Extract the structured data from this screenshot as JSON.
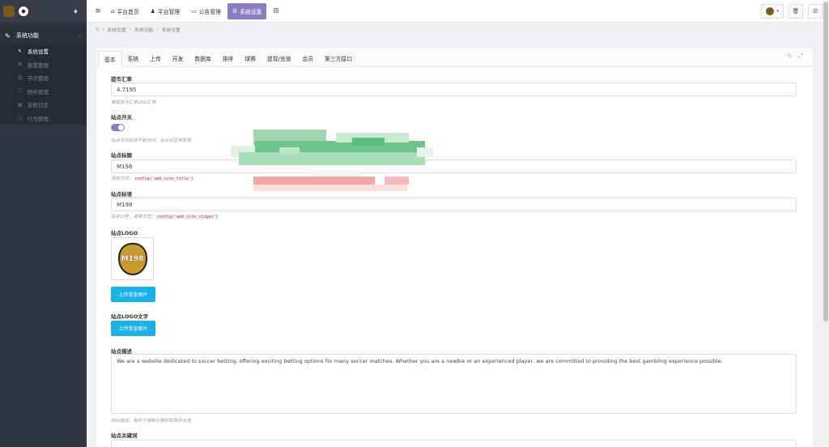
{
  "sidebar": {
    "group_label": "系统功能",
    "items": [
      {
        "label": "系统设置",
        "icon": "wrench-icon",
        "glyph": "✎",
        "active": true
      },
      {
        "label": "配置管理",
        "icon": "config-icon",
        "glyph": "⚙",
        "active": false
      },
      {
        "label": "节点管理",
        "icon": "node-icon",
        "glyph": "☰",
        "active": false
      },
      {
        "label": "附件管理",
        "icon": "attachment-icon",
        "glyph": "☐",
        "active": false
      },
      {
        "label": "系统日志",
        "icon": "log-icon",
        "glyph": "▤",
        "active": false
      },
      {
        "label": "行为管理",
        "icon": "action-icon",
        "glyph": "▢",
        "active": false
      }
    ]
  },
  "topnav": {
    "items": [
      {
        "label": "平台首页",
        "icon": "home-icon",
        "glyph": "⌂"
      },
      {
        "label": "平台管理",
        "icon": "user-icon",
        "glyph": "♟"
      },
      {
        "label": "公告管理",
        "icon": "notice-icon",
        "glyph": "▭"
      },
      {
        "label": "系统设置",
        "icon": "gear-icon",
        "glyph": "⚙",
        "active": true
      }
    ]
  },
  "breadcrumb": [
    "系统设置",
    "系统功能",
    "系统设置"
  ],
  "tabs": [
    "基本",
    "系统",
    "上传",
    "开发",
    "数据库",
    "排序",
    "球赛",
    "提现/充值",
    "会员",
    "第三方接口"
  ],
  "form": {
    "rate_label": "提币汇率",
    "rate_value": "4.7195",
    "rate_help": "美国货币汇率USD汇率",
    "switch_label": "站点开关",
    "switch_help": "站点关闭后将不能访问，后台可正常登录",
    "title_label": "站点标题",
    "title_value": "M198",
    "title_help_prefix": "调用方式：",
    "title_help_code": "config('web_site_title')",
    "slogan_label": "站点标语",
    "slogan_value": "M198",
    "slogan_help_prefix": "站点口号，调用方式：",
    "slogan_help_code": "config('web_site_slogan')",
    "logo_label": "站点LOGO",
    "logo_badge_text": "M198",
    "upload_label": "上传单张图片",
    "logo_text_label": "站点LOGO文字",
    "upload_label_2": "上传单张图片",
    "desc_label": "站点描述",
    "desc_value": "We are a website dedicated to soccer betting, offering exciting betting options for many soccer matches. Whether you are a newbie or an experienced player, we are committed to providing the best gambling experience possible.",
    "desc_help": "网站描述，有利于搜索引擎抓取相关信息",
    "keywords_label": "站点关键词"
  },
  "colors": {
    "accent": "#8e7cc3",
    "button": "#1ab1e6",
    "sidebar": "#2f3542"
  }
}
